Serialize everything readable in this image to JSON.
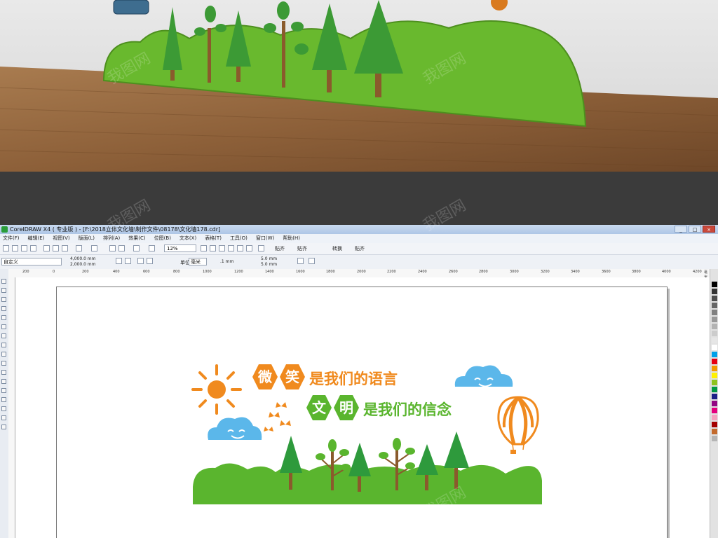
{
  "window": {
    "title": "CorelDRAW X4 ( 专业版 ) - [F:\\2018立体文化墙\\制作文件\\08178\\文化墙178.cdr]",
    "buttons": [
      "_",
      "□",
      "×"
    ]
  },
  "menu": [
    "文件(F)",
    "编辑(E)",
    "视图(V)",
    "版面(L)",
    "排列(A)",
    "效果(C)",
    "位图(B)",
    "文本(X)",
    "表格(T)",
    "工具(O)",
    "窗口(W)",
    "帮助(H)"
  ],
  "toolbar": {
    "zoom": "12%",
    "snap_items": [
      "贴齐",
      "贴齐",
      "转换",
      "贴齐"
    ]
  },
  "property_bar": {
    "preset": "自定义",
    "width": "4,000.0 mm",
    "height": "2,000.0 mm",
    "unit_label": "单位:",
    "unit": "毫米",
    "nudge": ".1 mm",
    "dup_x": "5.0 mm",
    "dup_y": "5.0 mm"
  },
  "ruler": {
    "ticks": [
      "200",
      "0",
      "200",
      "400",
      "600",
      "800",
      "1000",
      "1200",
      "1400",
      "1600",
      "1800",
      "2000",
      "2200",
      "2400",
      "2600",
      "2800",
      "3000",
      "3200",
      "3400",
      "3600",
      "3800",
      "4000",
      "4200"
    ],
    "unit": "毫米"
  },
  "artwork": {
    "line1_badges": [
      "微",
      "笑"
    ],
    "line1_text": "是我们的语言",
    "line2_badges": [
      "文",
      "明"
    ],
    "line2_text": "是我们的信念"
  },
  "colors": {
    "orange": "#f08a1e",
    "green": "#5ab52e",
    "dark_green": "#2e9a3c",
    "sky_blue": "#5bb7ea",
    "brown": "#8a5a2c",
    "palette": [
      "#000000",
      "#333333",
      "#4d4d4d",
      "#666666",
      "#808080",
      "#999999",
      "#b3b3b3",
      "#cccccc",
      "#e6e6e6",
      "#ffffff",
      "#00a0e9",
      "#e60012",
      "#f39800",
      "#fff100",
      "#8fc31f",
      "#009944",
      "#00a0e9",
      "#1d2088",
      "#920783",
      "#e4007f",
      "#f5a2c0",
      "#a40000",
      "#c36a2d",
      "#b5b5b5"
    ]
  },
  "watermark": "我图网"
}
